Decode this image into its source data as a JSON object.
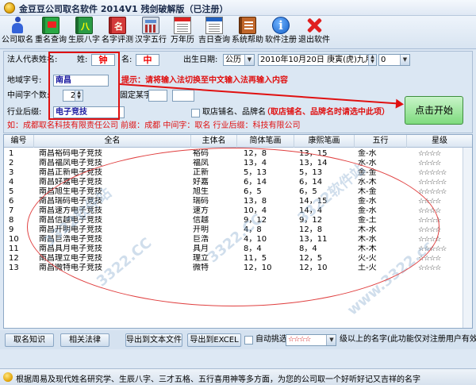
{
  "window": {
    "title": "金豆豆公司取名软件  2014V1 残剑破解版（已注册）"
  },
  "toolbar": {
    "items": [
      {
        "label": "公司取名",
        "icon": "person-icon"
      },
      {
        "label": "重名查询",
        "icon": "green-book-icon"
      },
      {
        "label": "生辰八字",
        "icon": "bazi-book-icon"
      },
      {
        "label": "名字评测",
        "icon": "name-book-icon"
      },
      {
        "label": "汉字五行",
        "icon": "calculator-icon"
      },
      {
        "label": "万年历",
        "icon": "calendar-icon"
      },
      {
        "label": "吉日查询",
        "icon": "calendar-blue-icon"
      },
      {
        "label": "系统帮助",
        "icon": "help-book-icon"
      },
      {
        "label": "软件注册",
        "icon": "info-icon"
      },
      {
        "label": "退出软件",
        "icon": "exit-x-icon"
      }
    ]
  },
  "form": {
    "legal_label": "法人代表姓名:",
    "surname_label": "姓:",
    "surname_value": "钟",
    "given_label": "名:",
    "given_value": "中",
    "birth_label": "出生日期:",
    "calendar_value": "公历",
    "birth_value": "2010年10月20日 庚寅(虎)九月十三",
    "hour_value": "0",
    "region_label": "地域字号:",
    "region_value": "南昌",
    "hint_text": "提示：请将输入法切换至中文输入法再输入内容",
    "mid_count_label": "中间字个数:",
    "mid_count_value": "2",
    "fixed_label": "固定某字:",
    "industry_label": "行业后缀:",
    "industry_value": "电子竞技",
    "shop_check_label": "取店铺名、品牌名",
    "shop_note": "（取店铺名、品牌名时请选中此项）",
    "example_text": "如：成都取名科技有限责任公司   前缀：成都   中间字：取名   行业后缀：科技有限公司",
    "start_button": "点击开始"
  },
  "grid": {
    "columns": [
      "编号",
      "全名",
      "主体名",
      "简体笔画",
      "康熙笔画",
      "五行",
      "星级"
    ],
    "rows": [
      [
        "1",
        "南昌裕码电子竞技",
        "裕码",
        "12，8",
        "13，15",
        "金-水",
        "☆☆☆☆"
      ],
      [
        "2",
        "南昌福凤电子竞技",
        "福凤",
        "13，4",
        "13，14",
        "水-水",
        "☆☆☆☆"
      ],
      [
        "3",
        "南昌正新电子竞技",
        "正新",
        "5，13",
        "5，13",
        "金-金",
        "☆☆☆☆☆"
      ],
      [
        "4",
        "南昌好嘉电子竞技",
        "好嘉",
        "6，14",
        "6，14",
        "水-木",
        "☆☆☆☆☆"
      ],
      [
        "5",
        "南昌旭生电子竞技",
        "旭生",
        "6，5",
        "6，5",
        "木-金",
        "☆☆☆☆☆"
      ],
      [
        "6",
        "南昌瑞码电子竞技",
        "瑞码",
        "13，8",
        "14，15",
        "金-水",
        "☆☆☆☆"
      ],
      [
        "7",
        "南昌速方电子竞技",
        "速方",
        "10，4",
        "14，4",
        "金-水",
        "☆☆☆☆"
      ],
      [
        "8",
        "南昌信越电子竞技",
        "信越",
        "9，12",
        "9，12",
        "金-土",
        "☆☆☆☆"
      ],
      [
        "9",
        "南昌开明电子竞技",
        "开明",
        "4，8",
        "12，8",
        "木-水",
        "☆☆☆☆"
      ],
      [
        "10",
        "南昌巨浩电子竞技",
        "巨浩",
        "4，10",
        "13，11",
        "木-水",
        "☆☆☆☆"
      ],
      [
        "11",
        "南昌具月电子竞技",
        "具月",
        "8，4",
        "8，4",
        "木-木",
        "☆☆☆☆☆"
      ],
      [
        "12",
        "南昌理立电子竞技",
        "理立",
        "11，5",
        "12，5",
        "火-火",
        "☆☆☆☆"
      ],
      [
        "13",
        "南昌微特电子竞技",
        "微特",
        "12，10",
        "12，10",
        "土-火",
        "☆☆☆☆"
      ]
    ],
    "watermarks": [
      "3322软件站",
      "3322.CC",
      "3322.CC",
      "3322软件站",
      "www.3322.cc"
    ]
  },
  "bottom": {
    "btn_knowledge": "取名知识",
    "btn_law": "相关法律",
    "btn_export_txt": "导出到文本文件",
    "btn_export_excel": "导出到EXCEL",
    "auto_select_label": "自动挑选",
    "star_value": "☆☆☆☆",
    "note": "级以上的名字(此功能仅对注册用户有效)"
  },
  "status": {
    "text": "根据周易及现代姓名研究学、生辰八字、三才五格、五行喜用神等多方面，为您的公司取一个好听好记又吉祥的名字"
  },
  "colors": {
    "accent_red": "#e01010",
    "start_green": "#7edb7e",
    "window_bg": "#dde8f4"
  }
}
